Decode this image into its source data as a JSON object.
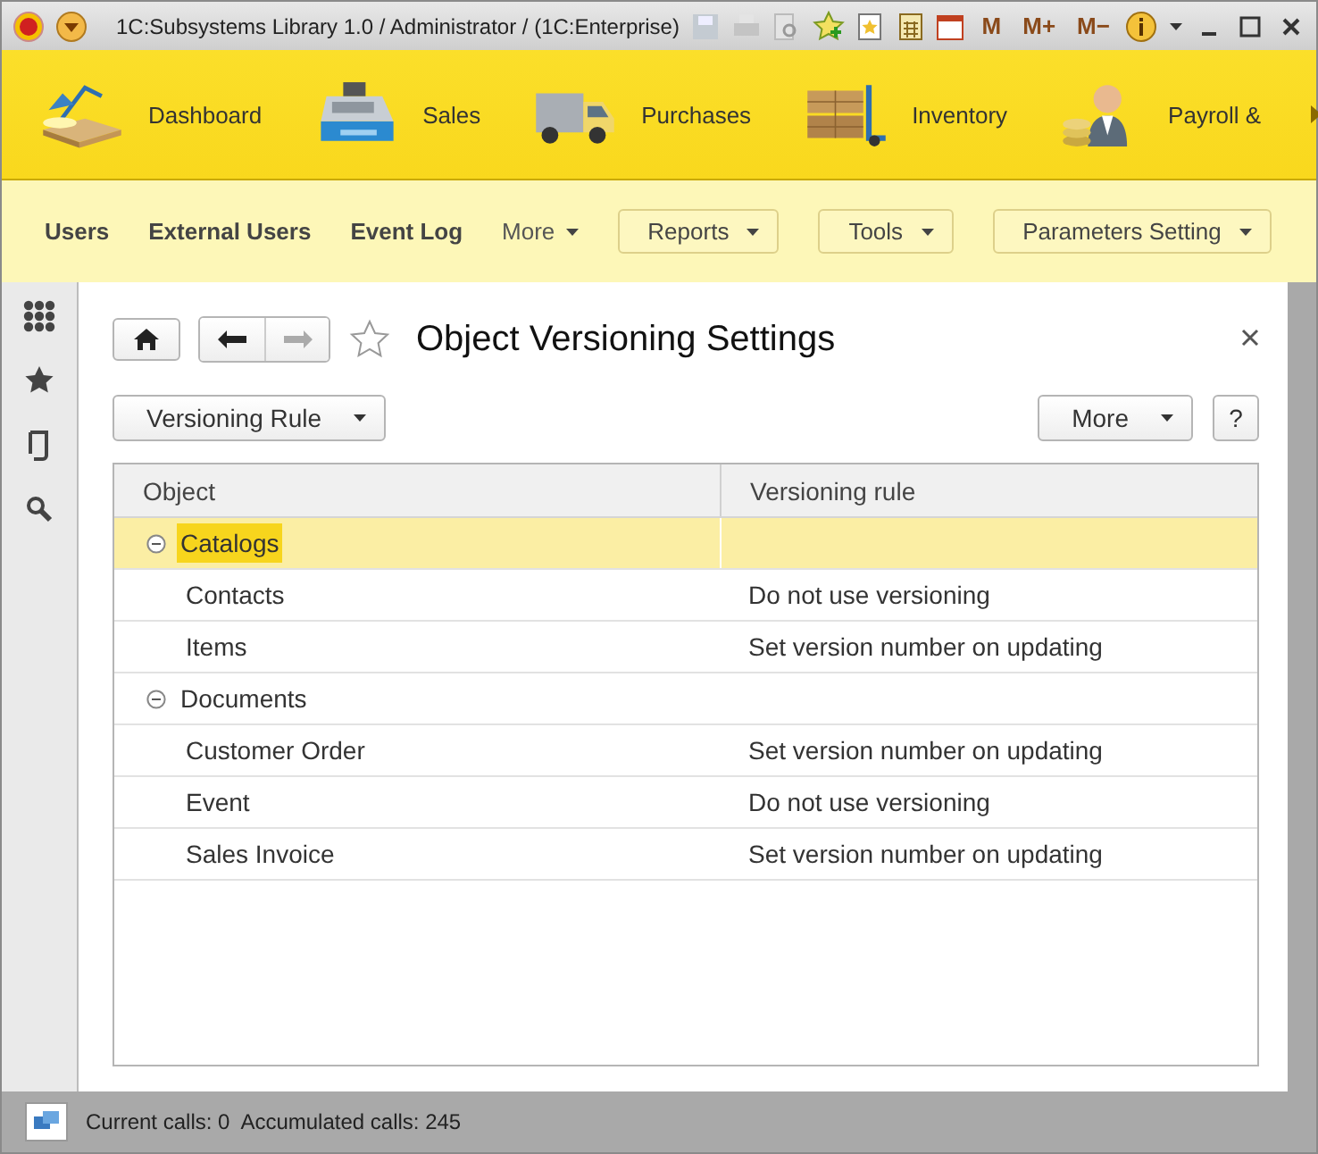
{
  "window": {
    "title": "1C:Subsystems Library 1.0 / Administrator /  (1C:Enterprise)",
    "memory_buttons": [
      "M",
      "M+",
      "M−"
    ]
  },
  "sections": [
    {
      "label": "Dashboard",
      "kind": "lamp"
    },
    {
      "label": "Sales",
      "kind": "register"
    },
    {
      "label": "Purchases",
      "kind": "van"
    },
    {
      "label": "Inventory",
      "kind": "boxes"
    },
    {
      "label": "Payroll &",
      "kind": "person"
    }
  ],
  "subnav": {
    "links": [
      "Users",
      "External Users",
      "Event Log"
    ],
    "more": "More",
    "menus": [
      "Reports",
      "Tools",
      "Parameters Setting"
    ]
  },
  "form": {
    "title": "Object Versioning Settings",
    "favorite": false,
    "toolbar": {
      "rule_button": "Versioning Rule",
      "more_button": "More",
      "help_button": "?"
    },
    "table": {
      "columns": [
        "Object",
        "Versioning rule"
      ],
      "rows": [
        {
          "object": "Catalogs",
          "rule": "",
          "expanded": true,
          "selected": true,
          "children": [
            {
              "object": "Contacts",
              "rule": "Do not use versioning",
              "selected": false
            },
            {
              "object": "Items",
              "rule": "Set version number on updating",
              "selected": false
            }
          ]
        },
        {
          "object": "Documents",
          "rule": "",
          "expanded": true,
          "selected": false,
          "children": [
            {
              "object": "Customer Order",
              "rule": "Set version number on updating",
              "selected": false
            },
            {
              "object": "Event",
              "rule": "Do not use versioning",
              "selected": false
            },
            {
              "object": "Sales Invoice",
              "rule": "Set version number on updating",
              "selected": false
            }
          ]
        }
      ]
    }
  },
  "status_bar": {
    "text": "Current calls: 0  Accumulated calls: 245"
  }
}
